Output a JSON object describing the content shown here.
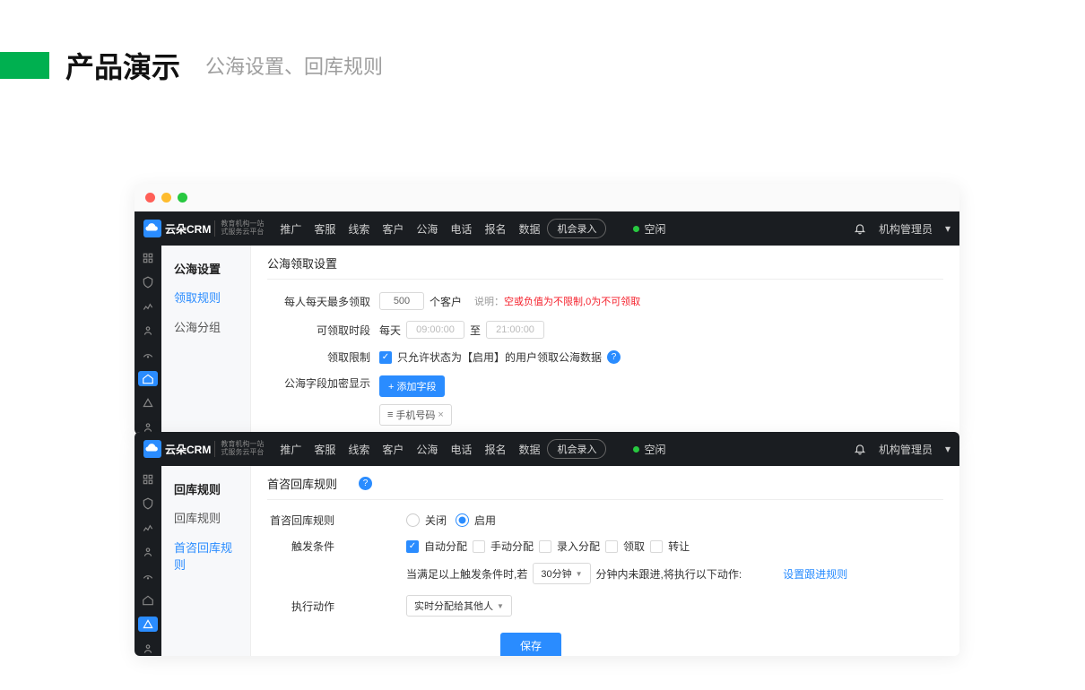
{
  "page": {
    "title": "产品演示",
    "subtitle": "公海设置、回库规则"
  },
  "common": {
    "logo_text": "云朵CRM",
    "logo_sub1": "教育机构一站",
    "logo_sub2": "式服务云平台",
    "nav": [
      "推广",
      "客服",
      "线索",
      "客户",
      "公海",
      "电话",
      "报名",
      "数据"
    ],
    "pill": "机会录入",
    "status": "空闲",
    "user": "机构管理员",
    "caret": "▾"
  },
  "card1": {
    "sidebar_title": "公海设置",
    "sidebar_items": [
      "领取规则",
      "公海分组"
    ],
    "sidebar_active": 0,
    "content_header": "公海领取设置",
    "rows": {
      "r1_label": "每人每天最多领取",
      "r1_value": "500",
      "r1_unit": "个客户",
      "r1_note_pre": "说明：",
      "r1_note": "空或负值为不限制,0为不可领取",
      "r2_label": "可领取时段",
      "r2_every": "每天",
      "r2_from": "09:00:00",
      "r2_to_word": "至",
      "r2_to": "21:00:00",
      "r3_label": "领取限制",
      "r3_text": "只允许状态为【启用】的用户领取公海数据",
      "r4_label": "公海字段加密显示",
      "r4_btn": "+ 添加字段",
      "r4_tag_icon": "≡",
      "r4_tag": "手机号码",
      "r4_tag_x": "×"
    }
  },
  "card2": {
    "sidebar_title": "回库规则",
    "sidebar_items": [
      "回库规则",
      "首咨回库规则"
    ],
    "sidebar_active": 1,
    "content_header": "首咨回库规则",
    "rows": {
      "r1_label": "首咨回库规则",
      "r1_off": "关闭",
      "r1_on": "启用",
      "r2_label": "触发条件",
      "r2_opts": [
        "自动分配",
        "手动分配",
        "录入分配",
        "领取",
        "转让"
      ],
      "r2_checked": 0,
      "r2_line2a": "当满足以上触发条件时,若",
      "r2_sel": "30分钟",
      "r2_line2b": "分钟内未跟进,将执行以下动作:",
      "r2_link": "设置跟进规则",
      "r3_label": "执行动作",
      "r3_sel": "实时分配给其他人",
      "save": "保存"
    }
  }
}
